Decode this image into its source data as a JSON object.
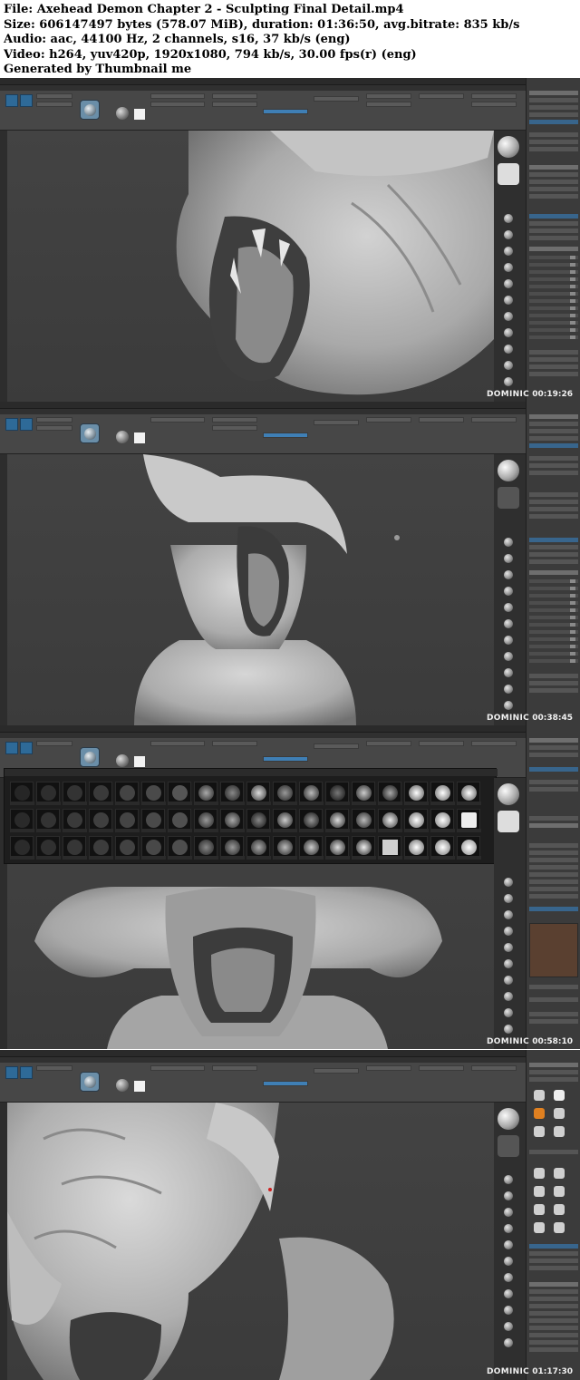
{
  "info": {
    "file": "File: Axehead Demon Chapter 2 - Sculpting Final Detail.mp4",
    "size": "Size: 606147497 bytes (578.07 MiB), duration: 01:36:50, avg.bitrate: 835 kb/s",
    "audio": "Audio: aac, 44100 Hz, 2 channels, s16, 37 kb/s (eng)",
    "video": "Video: h264, yuv420p, 1920x1080, 794 kb/s, 30.00 fps(r) (eng)",
    "generator": "Generated by Thumbnail me"
  },
  "frames": [
    {
      "watermark": "DOMINIC",
      "timecode": "00:19:26"
    },
    {
      "watermark": "DOMINIC",
      "timecode": "00:38:45"
    },
    {
      "watermark": "DOMINIC",
      "timecode": "00:58:10"
    },
    {
      "watermark": "DOMINIC",
      "timecode": "01:17:30"
    }
  ],
  "colors": {
    "ui_dark": "#3a3a3a",
    "ui_toolbar": "#474747",
    "ui_accent": "#3f7fb5",
    "model_clay": "#b4b4b4"
  }
}
